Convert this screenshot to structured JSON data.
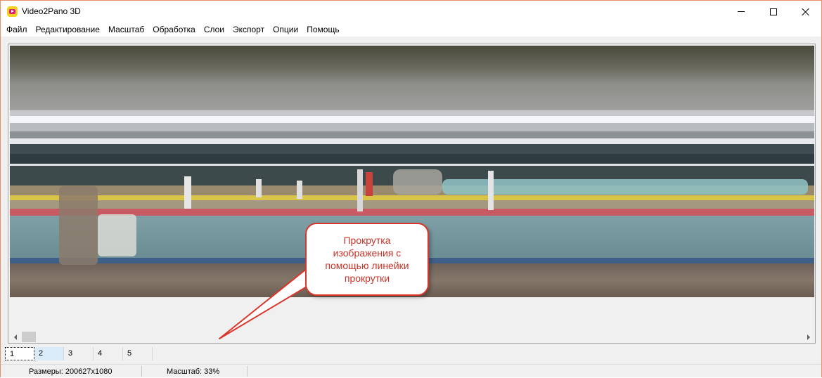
{
  "window": {
    "title": "Video2Pano 3D",
    "icon": "video2pano-app-icon",
    "controls": [
      "minimize-icon",
      "maximize-icon",
      "close-icon"
    ]
  },
  "menu": {
    "items": [
      "Файл",
      "Редактирование",
      "Масштаб",
      "Обработка",
      "Слои",
      "Экспорт",
      "Опции",
      "Помощь"
    ]
  },
  "layer_tabs": {
    "items": [
      "1",
      "2",
      "3",
      "4",
      "5"
    ],
    "selected": "1"
  },
  "status": {
    "size": "Размеры: 200627x1080",
    "scale": "Масштаб: 33%"
  },
  "callout": {
    "text": "Прокрутка изображения с помощью линейки прокрутки"
  },
  "colors": {
    "callout_border": "#d9352a",
    "callout_text": "#c8342a",
    "window_border": "#e8906a"
  }
}
